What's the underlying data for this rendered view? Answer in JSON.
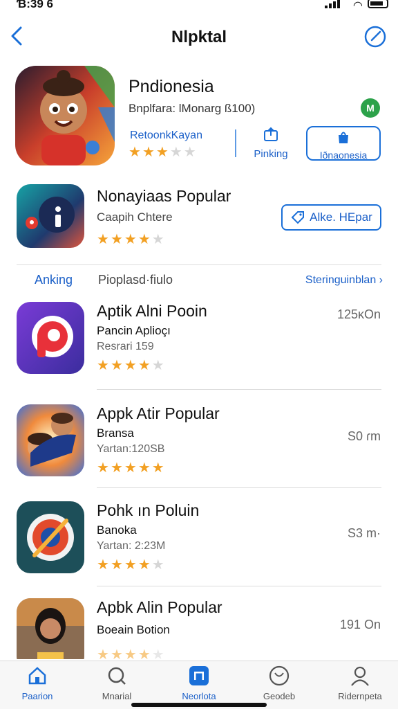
{
  "status": {
    "time": "Ɓ:39 6"
  },
  "nav": {
    "title": "Nlpktal"
  },
  "featured": {
    "name": "Pndionesia",
    "subtitle": "Bnplfara: lMonarg ß100)",
    "badge": "M",
    "link": "RetoonkKayan",
    "rating": 3,
    "ranking_label": "Pinking",
    "region_button": "Iðnaonesia"
  },
  "second": {
    "name": "Nonayiaas  Popular",
    "subtitle": "Caapih Chtere",
    "rating": 4,
    "button": "Alke. HEpar"
  },
  "section": {
    "tab_ranking": "Anking",
    "tab_popular": "Pioplasd·fiulo",
    "see_all": "Steringuinblan ›"
  },
  "apps": [
    {
      "title": "Aptik Alni Pooin",
      "sub1": "Pancin Aplioçı",
      "sub2": "Resrari 159",
      "meta": "125ĸOn",
      "rating": 4
    },
    {
      "title": "Appk Atir Popular",
      "sub1": "Bransa",
      "sub2": "Yartan:120SB",
      "meta": "S0 ɾm",
      "rating": 5
    },
    {
      "title": "Pohk ın Poluin",
      "sub1": "Banoka",
      "sub2": "Yartan: 2:23M",
      "meta": "S3 m·",
      "rating": 4
    },
    {
      "title": "Apbk Alin Popular",
      "sub1": "Boeain Botion",
      "sub2": "",
      "meta": "191 On",
      "rating": 4
    }
  ],
  "tabs": [
    {
      "label": "Paarion",
      "icon": "home-icon",
      "active": true
    },
    {
      "label": "Mnarial",
      "icon": "search-icon",
      "active": false
    },
    {
      "label": "Neorlota",
      "icon": "apps-icon",
      "active": true
    },
    {
      "label": "Geodeb",
      "icon": "game-icon",
      "active": false
    },
    {
      "label": "Ridernpeta",
      "icon": "profile-icon",
      "active": false
    }
  ],
  "colors": {
    "accent": "#1a6fd8",
    "star": "#f2a023",
    "badge": "#2ca24a"
  }
}
